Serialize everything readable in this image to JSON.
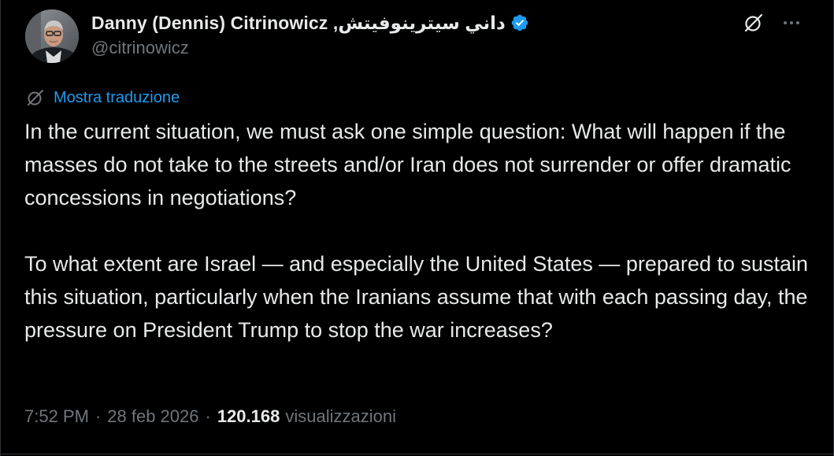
{
  "author": {
    "display_name": "Danny (Dennis) Citrinowicz ,داني سيترينوفيتش",
    "handle": "@citrinowicz",
    "verified": true,
    "verified_color": "#1d9bf0"
  },
  "actions": {
    "grok_icon": "grok-icon",
    "more_icon": "more-icon"
  },
  "translate": {
    "label": "Mostra traduzione",
    "icon": "grok-icon"
  },
  "tweet": {
    "paragraphs": [
      "In the current situation, we must ask one simple question: What will happen if the masses do not take to the streets and/or Iran does not surrender or offer dramatic concessions in negotiations?",
      "To what extent are Israel — and especially the United States — prepared to sustain this situation, particularly when the Iranians assume that with each passing day, the pressure on President Trump to stop the war increases?"
    ]
  },
  "meta": {
    "time": "7:52 PM",
    "separator": "·",
    "date": "28 feb 2026",
    "views_count": "120.168",
    "views_label": "visualizzazioni"
  },
  "colors": {
    "background": "#000000",
    "text_primary": "#e7e9ea",
    "text_secondary": "#71767b",
    "link": "#1d9bf0",
    "border": "#2f3336"
  }
}
